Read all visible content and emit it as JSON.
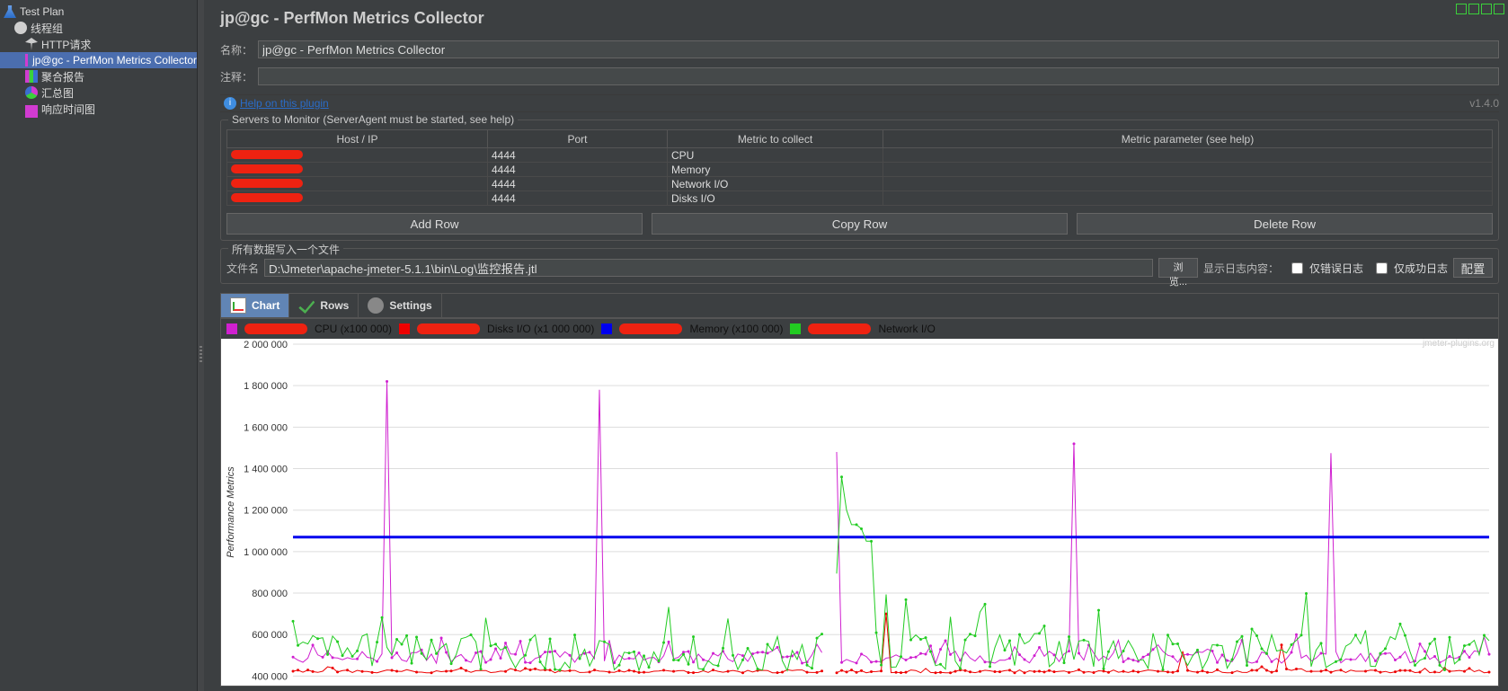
{
  "tree": {
    "items": [
      {
        "label": "Test Plan",
        "indent": "l1",
        "icon": "ico-flask",
        "sel": false
      },
      {
        "label": "线程组",
        "indent": "l2",
        "icon": "ico-gear",
        "sel": false
      },
      {
        "label": "HTTP请求",
        "indent": "l3",
        "icon": "ico-pin",
        "sel": false
      },
      {
        "label": "jp@gc - PerfMon Metrics Collector",
        "indent": "l3",
        "icon": "ico-chart",
        "sel": true
      },
      {
        "label": "聚合报告",
        "indent": "l3",
        "icon": "ico-bar",
        "sel": false
      },
      {
        "label": "汇总图",
        "indent": "l3",
        "icon": "ico-pie",
        "sel": false
      },
      {
        "label": "响应时间图",
        "indent": "l3",
        "icon": "ico-line",
        "sel": false
      }
    ]
  },
  "header": {
    "title": "jp@gc - PerfMon Metrics Collector"
  },
  "form": {
    "name_label": "名称：",
    "name_value": "jp@gc - PerfMon Metrics Collector",
    "comment_label": "注释："
  },
  "help": {
    "link_text": "Help on this plugin",
    "version": "v1.4.0"
  },
  "servers_group": {
    "caption": "Servers to Monitor (ServerAgent must be started, see help)",
    "columns": [
      "Host / IP",
      "Port",
      "Metric to collect",
      "Metric parameter (see help)"
    ],
    "rows": [
      {
        "host": "[redacted]",
        "port": "4444",
        "metric": "CPU",
        "param": ""
      },
      {
        "host": "[redacted]",
        "port": "4444",
        "metric": "Memory",
        "param": ""
      },
      {
        "host": "[redacted]",
        "port": "4444",
        "metric": "Network I/O",
        "param": ""
      },
      {
        "host": "[redacted]",
        "port": "4444",
        "metric": "Disks I/O",
        "param": ""
      }
    ],
    "buttons": {
      "add": "Add Row",
      "copy": "Copy Row",
      "delete": "Delete Row"
    }
  },
  "file_group": {
    "caption": "所有数据写入一个文件",
    "file_label": "文件名",
    "file_value": "D:\\Jmeter\\apache-jmeter-5.1.1\\bin\\Log\\监控报告.jtl",
    "browse": "浏览...",
    "show_log_label": "显示日志内容：",
    "err_only": "仅错误日志",
    "ok_only": "仅成功日志",
    "config": "配置"
  },
  "tabs": [
    {
      "label": "Chart",
      "icon": "tico-chart",
      "active": true
    },
    {
      "label": "Rows",
      "icon": "tico-rows",
      "active": false
    },
    {
      "label": "Settings",
      "icon": "tico-gear",
      "active": false
    }
  ],
  "legend": [
    {
      "color": "#d020d0",
      "half": true,
      "text": "CPU (x100 000)"
    },
    {
      "color": "#ee0000",
      "half": true,
      "text": "Disks I/O (x1 000 000)"
    },
    {
      "color": "#0000ee",
      "half": true,
      "text": "Memory (x100 000)"
    },
    {
      "color": "#22cc22",
      "half": true,
      "text": "Network I/O"
    }
  ],
  "watermark": "jmeter-plugins.org",
  "chart_data": {
    "type": "line",
    "ylabel": "Performance Metrics",
    "ylim": [
      380000,
      2000000
    ],
    "yticks": [
      400000,
      600000,
      800000,
      1000000,
      1200000,
      1400000,
      1600000,
      1800000,
      2000000
    ],
    "ytick_labels": [
      "400 000",
      "600 000",
      "800 000",
      "1 000 000",
      "1 200 000",
      "1 400 000",
      "1 600 000",
      "1 800 000",
      "2 000 000"
    ],
    "x_range": [
      0,
      1210
    ],
    "series": [
      {
        "name": "CPU (x100 000)",
        "color": "#d020d0",
        "mode": "spiky",
        "base": 480000,
        "noise": 60000,
        "spikes": [
          {
            "x": 95,
            "y": 1820000
          },
          {
            "x": 310,
            "y": 1780000
          },
          {
            "x": 550,
            "y": 1480000
          },
          {
            "x": 790,
            "y": 1520000
          },
          {
            "x": 1050,
            "y": 1475000
          }
        ],
        "gap": [
          540,
          547
        ]
      },
      {
        "name": "Disks I/O (x1 000 000)",
        "color": "#ee0000",
        "mode": "spiky",
        "base": 420000,
        "noise": 15000,
        "spikes": [
          {
            "x": 600,
            "y": 700000
          },
          {
            "x": 900,
            "y": 520000
          },
          {
            "x": 1000,
            "y": 550000
          }
        ],
        "gap": [
          540,
          547
        ]
      },
      {
        "name": "Memory (x100 000)",
        "color": "#0000ee",
        "mode": "flat",
        "value": 1070000,
        "thickness": 3
      },
      {
        "name": "Network I/O",
        "color": "#22cc22",
        "mode": "spiky",
        "base": 480000,
        "noise": 180000,
        "spikes": [
          {
            "x": 557,
            "y": 1360000
          },
          {
            "x": 562,
            "y": 1200000
          },
          {
            "x": 568,
            "y": 1130000
          },
          {
            "x": 575,
            "y": 1110000
          },
          {
            "x": 582,
            "y": 1050000
          }
        ],
        "gap": [
          540,
          547
        ],
        "dense_region": [
          550,
          600
        ]
      }
    ]
  }
}
